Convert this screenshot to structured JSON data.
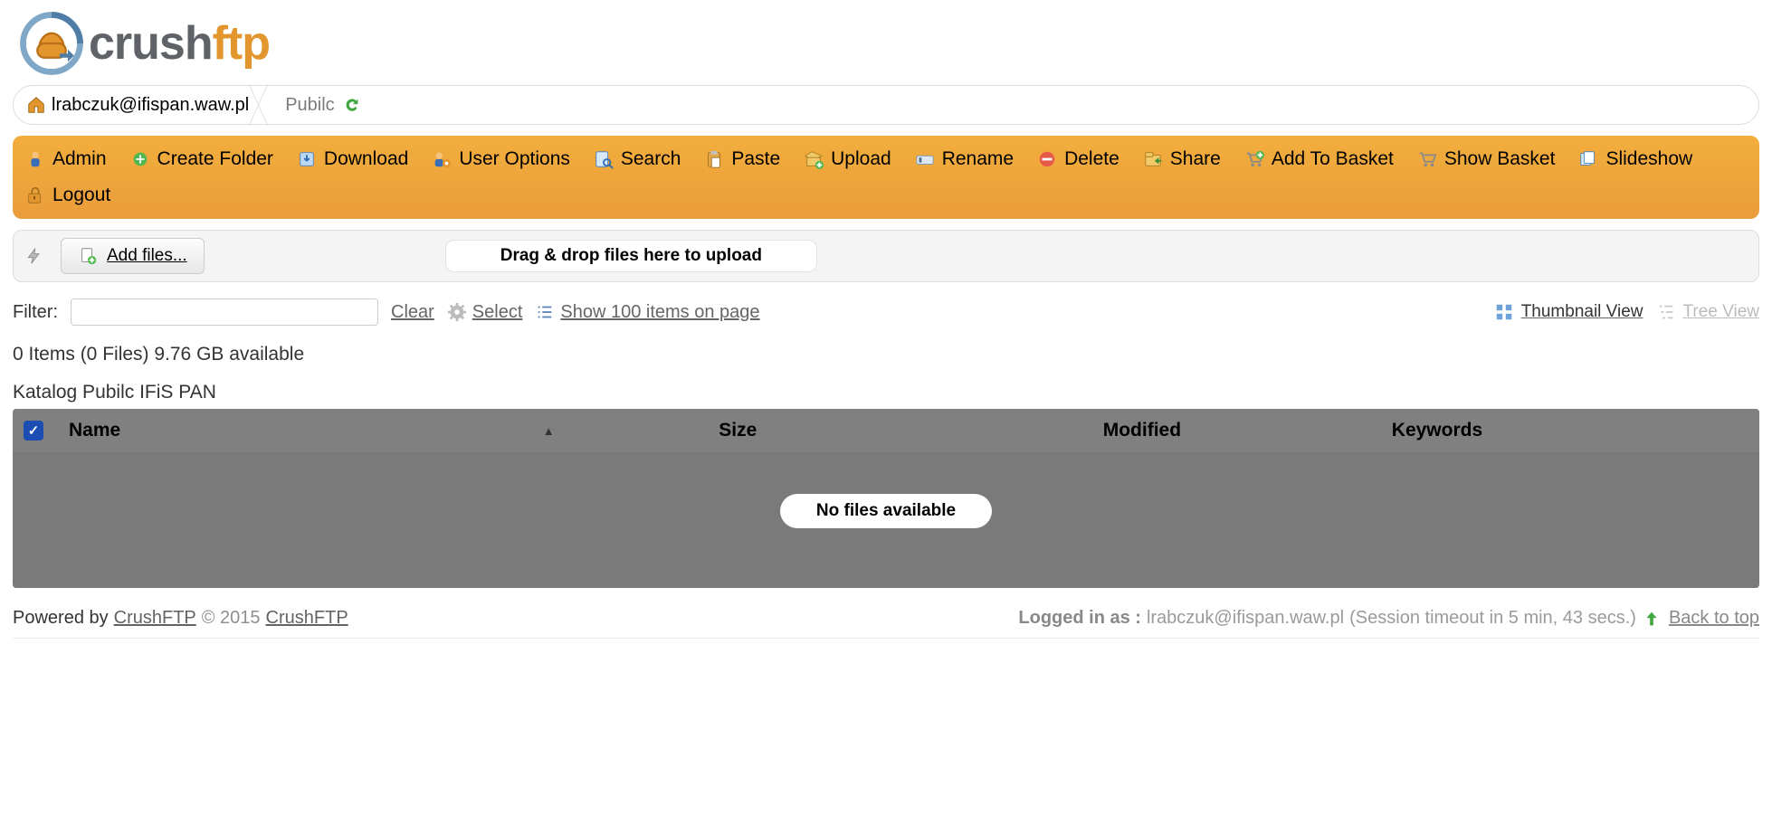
{
  "logo": {
    "crush": "crush",
    "ftp": "ftp"
  },
  "breadcrumb": {
    "home_label": "lrabczuk@ifispan.waw.pl",
    "folder_label": "Pubilc"
  },
  "toolbar": {
    "admin": "Admin",
    "create_folder": "Create Folder",
    "download": "Download",
    "user_options": "User Options",
    "search": "Search",
    "paste": "Paste",
    "upload": "Upload",
    "rename": "Rename",
    "delete": "Delete",
    "share": "Share",
    "add_basket": "Add To Basket",
    "show_basket": "Show Basket",
    "slideshow": "Slideshow",
    "logout": "Logout"
  },
  "upload": {
    "add_files": "Add files...",
    "dropzone": "Drag & drop files here to upload"
  },
  "filter": {
    "label": "Filter:",
    "clear": "Clear",
    "select": "Select",
    "paging": "Show 100 items on page",
    "thumbnail_view": "Thumbnail View",
    "tree_view": "Tree View",
    "value": ""
  },
  "status": {
    "items_line": "0 Items (0 Files)   9.76 GB available",
    "catalog": "Katalog Pubilc IFiS PAN"
  },
  "table": {
    "cols": {
      "name": "Name",
      "size": "Size",
      "modified": "Modified",
      "keywords": "Keywords"
    },
    "empty": "No files available"
  },
  "footer": {
    "powered_by": "Powered by",
    "link1": "CrushFTP",
    "copyright": "© 2015",
    "link2": "CrushFTP",
    "logged_in_label": "Logged in as :",
    "user": "lrabczuk@ifispan.waw.pl",
    "session_info": "(Session timeout in 5 min, 43 secs.)",
    "back_to_top": "Back to top"
  }
}
